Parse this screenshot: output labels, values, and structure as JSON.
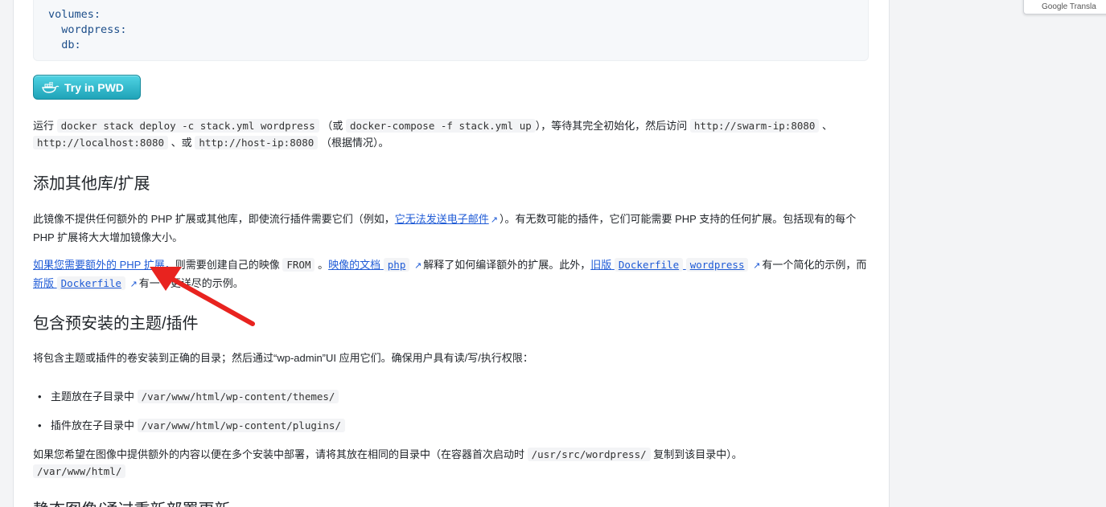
{
  "code": {
    "lines": [
      "volumes:",
      "  wordpress:",
      "  db:"
    ]
  },
  "pwd_button": {
    "label": "Try in PWD"
  },
  "run": {
    "p1": "运行",
    "c1": "docker stack deploy -c stack.yml wordpress",
    "p2": "（或",
    "c2": "docker-compose -f stack.yml up",
    "p3": "），等待其完全初始化，然后访问",
    "c3": "http://swarm-ip:8080",
    "p4": "、",
    "c4": "http://localhost:8080",
    "p5": "、或",
    "c5": "http://host-ip:8080",
    "p6": "（根据情况）。"
  },
  "section1": {
    "title": "添加其他库/扩展",
    "para1_a": "此镜像不提供任何额外的 PHP 扩展或其他库，即使流行插件需要它们（例如，",
    "para1_link": "它无法发送电子邮件",
    "para1_b": "）。有无数可能的插件，它们可能需要 PHP 支持的任何扩展。包括现有的每个 PHP 扩展将大大增加镜像大小。",
    "para2_link1": "如果您需要额外的 PHP 扩展，",
    "para2_a": "则需要创建自己的映像",
    "para2_code1": "FROM",
    "para2_b": "。",
    "para2_link2": "映像的文档",
    "para2_code2": "php",
    "para2_c": "解释了如何编译额外的扩展。此外，",
    "para2_link3": "旧版",
    "para2_code3": "Dockerfile",
    "para2_code4": "wordpress",
    "para2_d": "有一个简化的示例，而",
    "para2_link4": "新版",
    "para2_code5": "Dockerfile",
    "para2_e": "有一个更详尽的示例。"
  },
  "section2": {
    "title": "包含预安装的主题/插件",
    "intro": "将包含主题或插件的卷安装到正确的目录；然后通过“wp-admin”UI 应用它们。确保用户具有读/写/执行权限：",
    "bullets": [
      {
        "text": "主题放在子目录中",
        "code": "/var/www/html/wp-content/themes/"
      },
      {
        "text": "插件放在子目录中",
        "code": "/var/www/html/wp-content/plugins/"
      }
    ],
    "outro_a": "如果您希望在图像中提供额外的内容以便在多个安装中部署，请将其放在相同的目录中（在容器首次启动时",
    "outro_code1": "/usr/src/wordpress/",
    "outro_b": "复制到该目录中）。",
    "outro_code2": "/var/www/html/"
  },
  "section3": {
    "title": "静态图像/通过重新部署更新"
  },
  "google_translate": {
    "label": "Google Transla"
  },
  "colors": {
    "link": "#1f5bd6",
    "arrow": "#e8231f",
    "pwd": "#2bb5c8"
  },
  "icons": [
    "docker-whale-icon",
    "external-link-icon",
    "annotation-arrow"
  ]
}
